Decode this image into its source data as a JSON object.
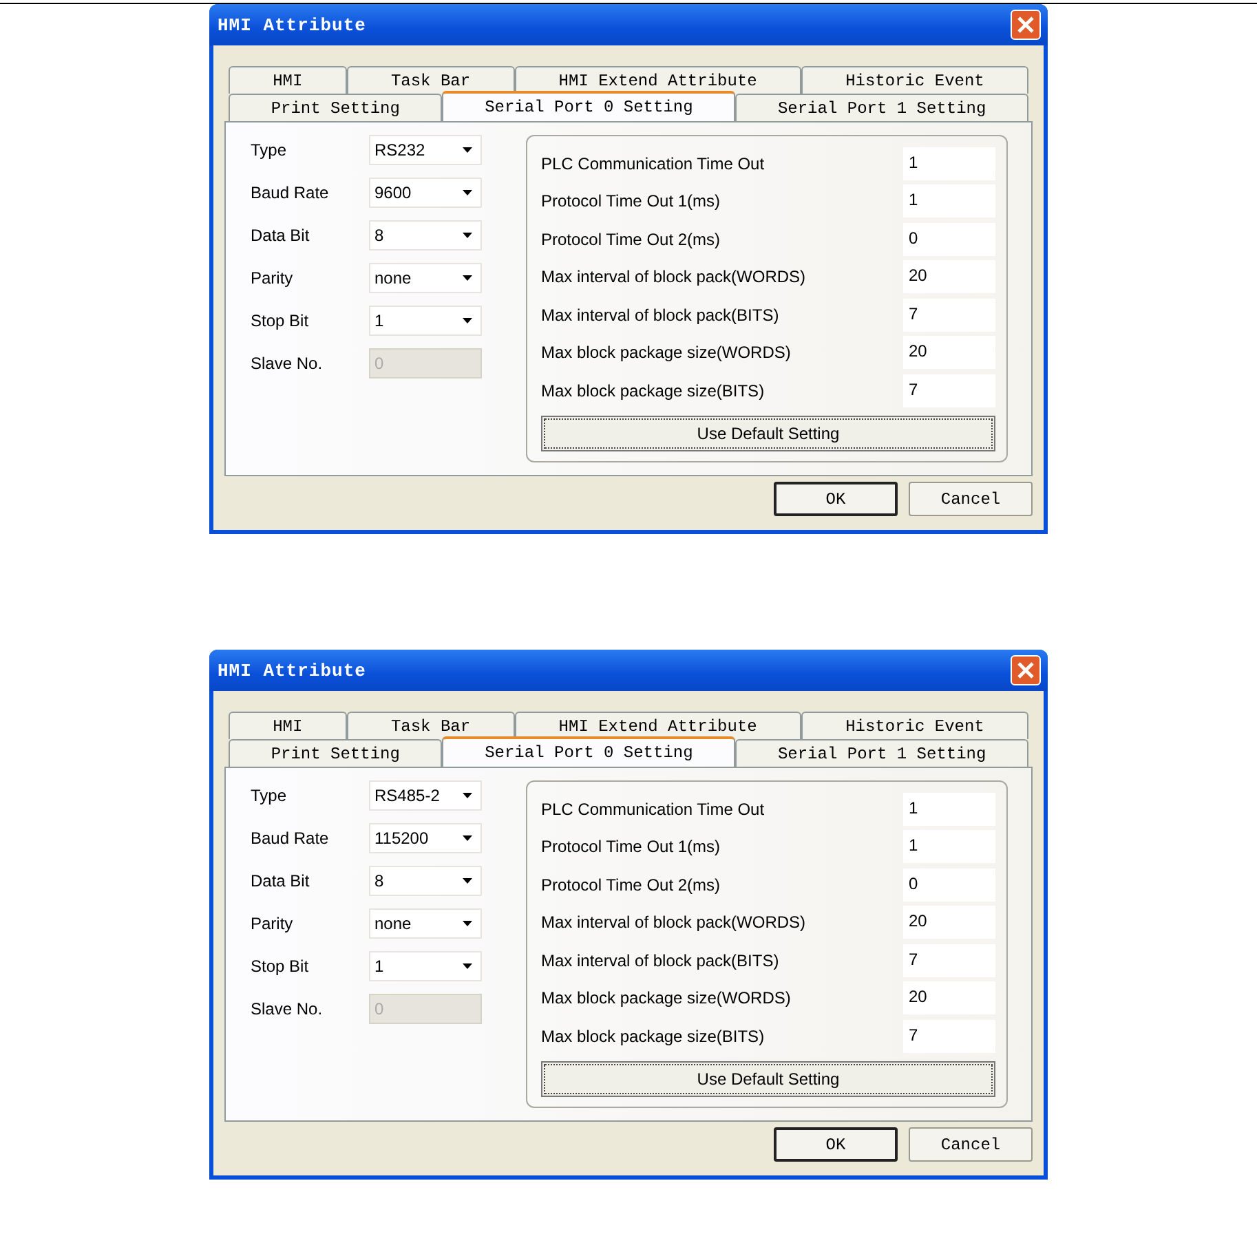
{
  "dialogs": [
    {
      "title": "HMI Attribute",
      "tab_rows": [
        [
          {
            "label": "HMI",
            "selected": false
          },
          {
            "label": "Task Bar",
            "selected": false
          },
          {
            "label": "HMI Extend Attribute",
            "selected": false
          },
          {
            "label": "Historic Event",
            "selected": false
          }
        ],
        [
          {
            "label": "Print Setting",
            "selected": false
          },
          {
            "label": "Serial Port 0 Setting",
            "selected": true
          },
          {
            "label": "Serial Port 1 Setting",
            "selected": false
          }
        ]
      ],
      "port_fields": [
        {
          "label": "Type",
          "value": "RS232",
          "kind": "dropdown",
          "disabled": false
        },
        {
          "label": "Baud Rate",
          "value": "9600",
          "kind": "dropdown",
          "disabled": false
        },
        {
          "label": "Data Bit",
          "value": "8",
          "kind": "dropdown",
          "disabled": false
        },
        {
          "label": "Parity",
          "value": "none",
          "kind": "dropdown",
          "disabled": false
        },
        {
          "label": "Stop Bit",
          "value": "1",
          "kind": "dropdown",
          "disabled": false
        },
        {
          "label": "Slave No.",
          "value": "0",
          "kind": "text",
          "disabled": true
        }
      ],
      "protocol_fields": [
        {
          "label": "PLC Communication Time Out",
          "value": "1"
        },
        {
          "label": "Protocol Time Out 1(ms)",
          "value": "1"
        },
        {
          "label": "Protocol Time Out 2(ms)",
          "value": "0"
        },
        {
          "label": "Max interval of block pack(WORDS)",
          "value": "20"
        },
        {
          "label": "Max interval of block pack(BITS)",
          "value": "7"
        },
        {
          "label": "Max block package size(WORDS)",
          "value": "20"
        },
        {
          "label": "Max block package size(BITS)",
          "value": "7"
        }
      ],
      "default_setting_button": "Use Default Setting",
      "buttons": [
        {
          "label": "OK",
          "default": true
        },
        {
          "label": "Cancel",
          "default": false
        }
      ]
    },
    {
      "title": "HMI Attribute",
      "tab_rows": [
        [
          {
            "label": "HMI",
            "selected": false
          },
          {
            "label": "Task Bar",
            "selected": false
          },
          {
            "label": "HMI Extend Attribute",
            "selected": false
          },
          {
            "label": "Historic Event",
            "selected": false
          }
        ],
        [
          {
            "label": "Print Setting",
            "selected": false
          },
          {
            "label": "Serial Port 0 Setting",
            "selected": true
          },
          {
            "label": "Serial Port 1 Setting",
            "selected": false
          }
        ]
      ],
      "port_fields": [
        {
          "label": "Type",
          "value": "RS485-2",
          "kind": "dropdown",
          "disabled": false
        },
        {
          "label": "Baud Rate",
          "value": "115200",
          "kind": "dropdown",
          "disabled": false
        },
        {
          "label": "Data Bit",
          "value": "8",
          "kind": "dropdown",
          "disabled": false
        },
        {
          "label": "Parity",
          "value": "none",
          "kind": "dropdown",
          "disabled": false
        },
        {
          "label": "Stop Bit",
          "value": "1",
          "kind": "dropdown",
          "disabled": false
        },
        {
          "label": "Slave No.",
          "value": "0",
          "kind": "text",
          "disabled": true
        }
      ],
      "protocol_fields": [
        {
          "label": "PLC Communication Time Out",
          "value": "1"
        },
        {
          "label": "Protocol Time Out 1(ms)",
          "value": "1"
        },
        {
          "label": "Protocol Time Out 2(ms)",
          "value": "0"
        },
        {
          "label": "Max interval of block pack(WORDS)",
          "value": "20"
        },
        {
          "label": "Max interval of block pack(BITS)",
          "value": "7"
        },
        {
          "label": "Max block package size(WORDS)",
          "value": "20"
        },
        {
          "label": "Max block package size(BITS)",
          "value": "7"
        }
      ],
      "default_setting_button": "Use Default Setting",
      "buttons": [
        {
          "label": "OK",
          "default": true
        },
        {
          "label": "Cancel",
          "default": false
        }
      ]
    }
  ]
}
